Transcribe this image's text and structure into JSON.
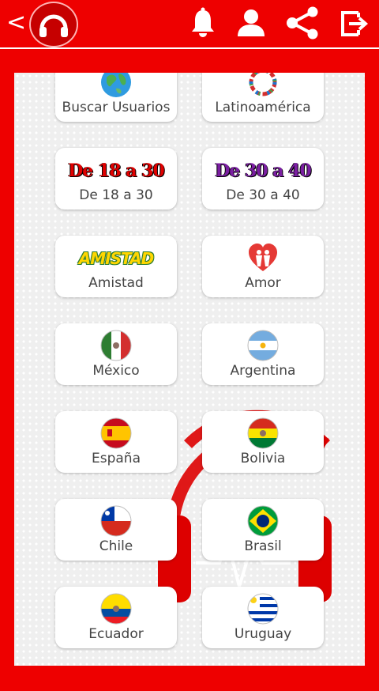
{
  "topbar": {
    "back_icon": "chevron-left-icon",
    "back_glyph": "<",
    "logo_icon": "headphones-logo-icon",
    "actions": [
      "bell-icon",
      "user-icon",
      "share-icon",
      "exit-icon"
    ]
  },
  "colors": {
    "brand": "#ee0000",
    "card": "#ffffff",
    "label": "#444444"
  },
  "rooms": [
    {
      "label": "Buscar Usuarios",
      "icon": "globe-icon"
    },
    {
      "label": "Latinoamérica",
      "icon": "flags-wreath-icon"
    },
    {
      "label": "De 18 a 30",
      "banner": "De 18 a 30",
      "icon": "age-banner-18-30"
    },
    {
      "label": "De 30 a 40",
      "banner": "De 30 a 40",
      "icon": "age-banner-30-40"
    },
    {
      "label": "Amistad",
      "banner": "AMISTAD",
      "icon": "amistad-banner"
    },
    {
      "label": "Amor",
      "icon": "heart-couple-icon"
    },
    {
      "label": "México",
      "icon": "mexico-flag-icon"
    },
    {
      "label": "Argentina",
      "icon": "argentina-flag-icon"
    },
    {
      "label": "España",
      "icon": "spain-flag-icon"
    },
    {
      "label": "Bolivia",
      "icon": "bolivia-flag-icon"
    },
    {
      "label": "Chile",
      "icon": "chile-flag-icon"
    },
    {
      "label": "Brasil",
      "icon": "brazil-flag-icon"
    },
    {
      "label": "Ecuador",
      "icon": "ecuador-flag-icon"
    },
    {
      "label": "Uruguay",
      "icon": "uruguay-flag-icon"
    }
  ]
}
